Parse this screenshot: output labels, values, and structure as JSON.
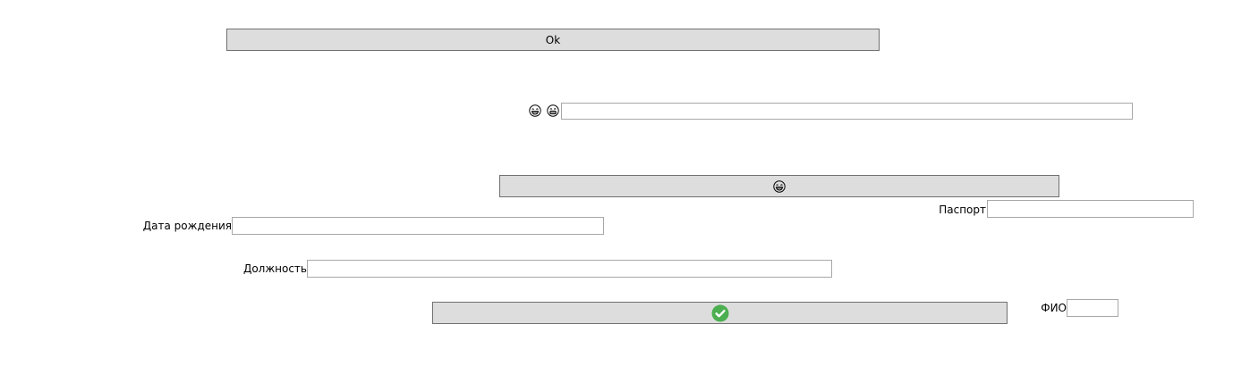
{
  "buttons": {
    "ok": {
      "label": "Ok"
    },
    "emoji_button": {
      "icon": "laughing-emoji-icon"
    },
    "confirm": {
      "icon": "green-check-circle-icon",
      "color": "#4caf50"
    }
  },
  "emoji_row": {
    "icons": [
      "laughing-emoji-icon",
      "grinning-emoji-icon"
    ],
    "input_value": ""
  },
  "fields": {
    "passport": {
      "label": "Паспорт",
      "value": ""
    },
    "birth_date": {
      "label": "Дата рождения",
      "value": ""
    },
    "position": {
      "label": "Должность",
      "value": ""
    },
    "full_name": {
      "label": "ФИО",
      "value": ""
    }
  },
  "colors": {
    "button_bg": "#dddddd",
    "button_border": "#707070",
    "field_border": "#a8a8a8",
    "check_green": "#4caf50"
  }
}
